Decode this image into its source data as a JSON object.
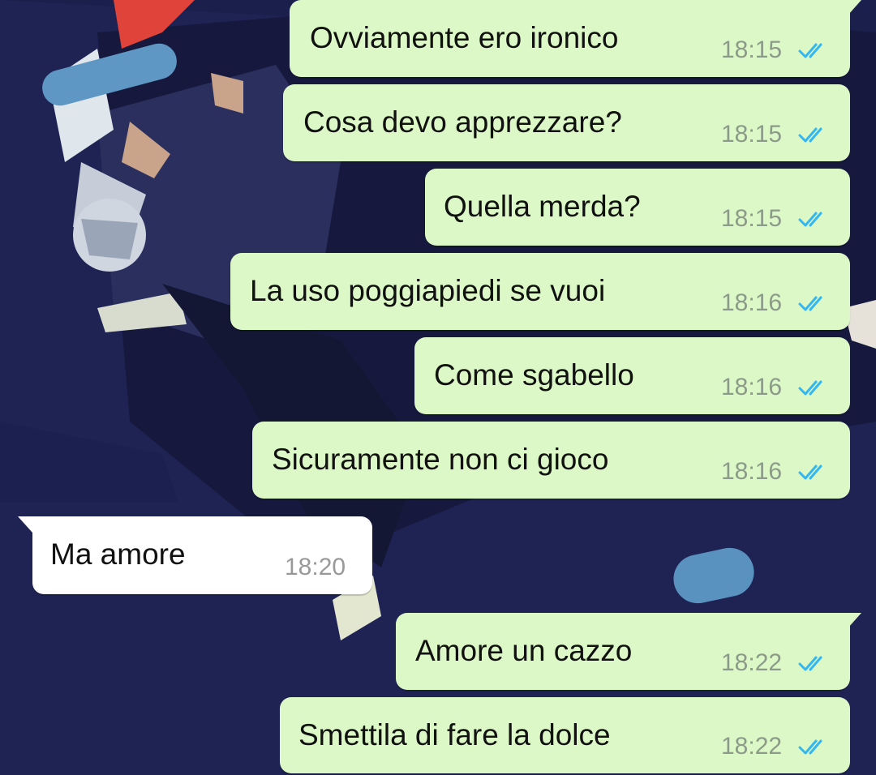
{
  "chat": {
    "messages": [
      {
        "direction": "out",
        "text": "Ovviamente ero ironico",
        "time": "18:15",
        "status": "read",
        "status_icon": "double-check-read-icon",
        "tail": true
      },
      {
        "direction": "out",
        "text": "Cosa devo apprezzare?",
        "time": "18:15",
        "status": "read",
        "status_icon": "double-check-read-icon",
        "tail": false
      },
      {
        "direction": "out",
        "text": "Quella merda?",
        "time": "18:15",
        "status": "read",
        "status_icon": "double-check-read-icon",
        "tail": false
      },
      {
        "direction": "out",
        "text": "La uso poggiapiedi se vuoi",
        "time": "18:16",
        "status": "read",
        "status_icon": "double-check-read-icon",
        "tail": false
      },
      {
        "direction": "out",
        "text": "Come sgabello",
        "time": "18:16",
        "status": "read",
        "status_icon": "double-check-read-icon",
        "tail": false
      },
      {
        "direction": "out",
        "text": "Sicuramente non ci gioco",
        "time": "18:16",
        "status": "read",
        "status_icon": "double-check-read-icon",
        "tail": false
      },
      {
        "direction": "in",
        "text": "Ma amore",
        "time": "18:20",
        "tail": true
      },
      {
        "direction": "out",
        "text": "Amore un cazzo",
        "time": "18:22",
        "status": "read",
        "status_icon": "double-check-read-icon",
        "tail": true
      },
      {
        "direction": "out",
        "text": "Smettila di fare la dolce",
        "time": "18:22",
        "status": "read",
        "status_icon": "double-check-read-icon",
        "tail": false
      }
    ]
  },
  "colors": {
    "outgoing_bubble": "#dcf8c6",
    "incoming_bubble": "#ffffff",
    "read_ticks": "#34b7f1",
    "wallpaper_base": "#1f2354"
  }
}
